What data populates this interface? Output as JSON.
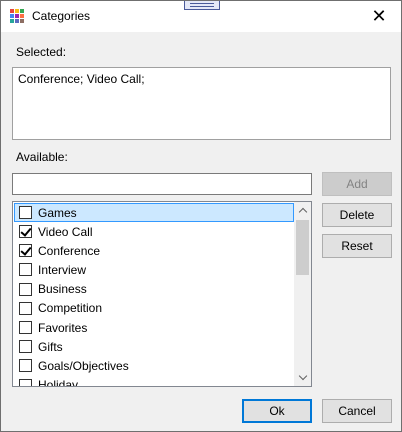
{
  "window": {
    "title": "Categories",
    "close_symbol": "✕"
  },
  "selected": {
    "label": "Selected:",
    "value": "Conference; Video Call;"
  },
  "available": {
    "label": "Available:",
    "filter_value": ""
  },
  "buttons": {
    "add": "Add",
    "delete": "Delete",
    "reset": "Reset",
    "ok": "Ok",
    "cancel": "Cancel"
  },
  "list": {
    "items": [
      {
        "label": "Games",
        "checked": false,
        "selected": true
      },
      {
        "label": "Video Call",
        "checked": true,
        "selected": false
      },
      {
        "label": "Conference",
        "checked": true,
        "selected": false
      },
      {
        "label": "Interview",
        "checked": false,
        "selected": false
      },
      {
        "label": "Business",
        "checked": false,
        "selected": false
      },
      {
        "label": "Competition",
        "checked": false,
        "selected": false
      },
      {
        "label": "Favorites",
        "checked": false,
        "selected": false
      },
      {
        "label": "Gifts",
        "checked": false,
        "selected": false
      },
      {
        "label": "Goals/Objectives",
        "checked": false,
        "selected": false
      },
      {
        "label": "Holiday",
        "checked": false,
        "selected": false
      }
    ]
  },
  "colors": {
    "accent": "#0078d7",
    "selection_bg": "#cce8ff",
    "selection_border": "#3399ff",
    "icon_colors": [
      "#e8453c",
      "#f9bc15",
      "#34a853",
      "#4285f4",
      "#9c27b0",
      "#ff7043",
      "#26a69a",
      "#5c6bc0",
      "#8d6e63"
    ]
  },
  "icons": {
    "app": "categories-grid-icon",
    "close": "close-icon",
    "checkbox": "checkbox-icon",
    "scroll_up": "scroll-up-arrow-icon",
    "scroll_down": "scroll-down-arrow-icon"
  }
}
